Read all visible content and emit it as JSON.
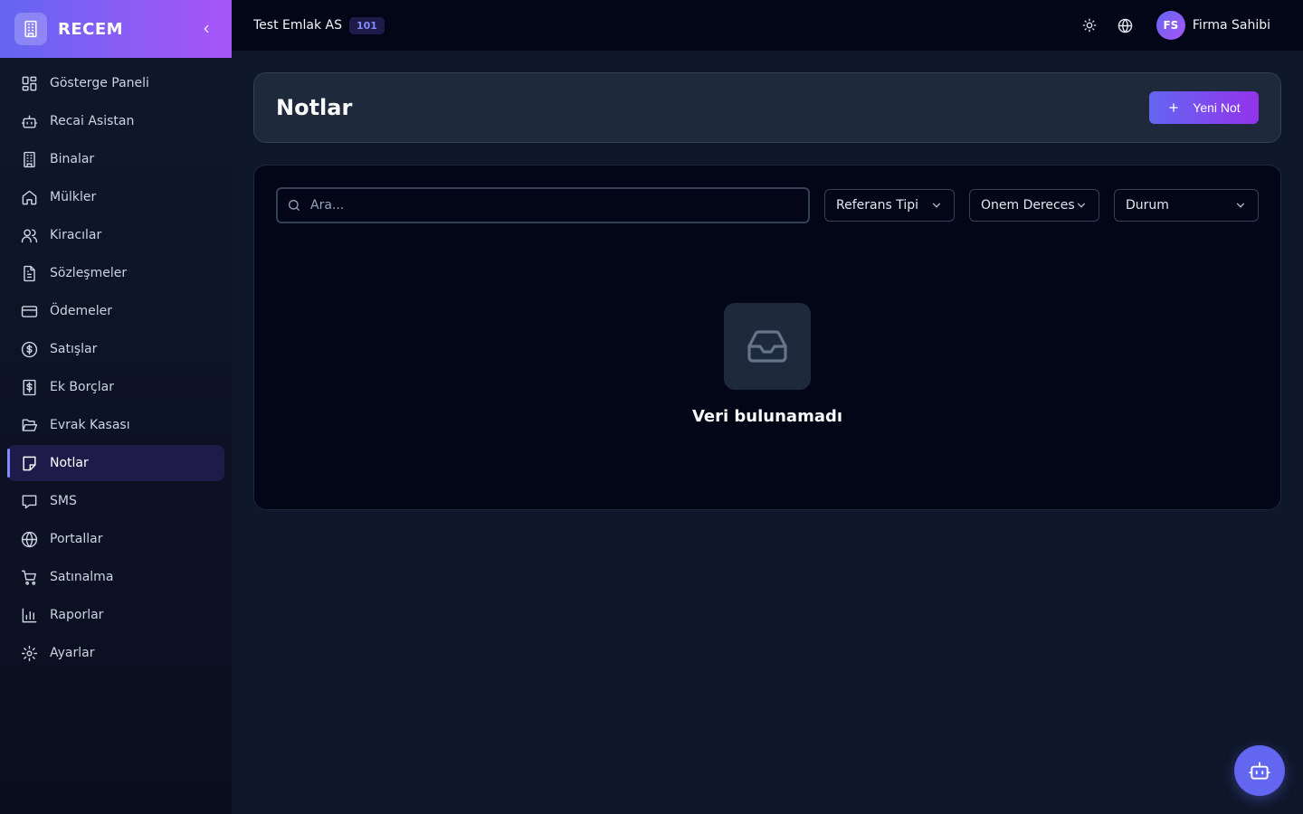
{
  "brand": {
    "name": "RECEM"
  },
  "sidebar": {
    "items": [
      {
        "label": "Gösterge Paneli",
        "icon": "dashboard-icon"
      },
      {
        "label": "Recai Asistan",
        "icon": "bot-icon"
      },
      {
        "label": "Binalar",
        "icon": "building-icon"
      },
      {
        "label": "Mülkler",
        "icon": "home-icon"
      },
      {
        "label": "Kiracılar",
        "icon": "users-icon"
      },
      {
        "label": "Sözleşmeler",
        "icon": "file-text-icon"
      },
      {
        "label": "Ödemeler",
        "icon": "credit-card-icon"
      },
      {
        "label": "Satışlar",
        "icon": "dollar-circle-icon"
      },
      {
        "label": "Ek Borçlar",
        "icon": "receipt-icon"
      },
      {
        "label": "Evrak Kasası",
        "icon": "folder-open-icon"
      },
      {
        "label": "Notlar",
        "icon": "sticky-note-icon",
        "active": true
      },
      {
        "label": "SMS",
        "icon": "message-icon"
      },
      {
        "label": "Portallar",
        "icon": "globe-icon"
      },
      {
        "label": "Satınalma",
        "icon": "cart-icon"
      },
      {
        "label": "Raporlar",
        "icon": "bar-chart-icon"
      },
      {
        "label": "Ayarlar",
        "icon": "settings-icon"
      }
    ]
  },
  "topbar": {
    "company": "Test Emlak AS",
    "company_code": "101",
    "user_initials": "FS",
    "user_name": "Firma Sahibi"
  },
  "page": {
    "title": "Notlar",
    "new_button": "Yeni Not"
  },
  "filters": {
    "search_placeholder": "Ara...",
    "reference_type": "Referans Tipi",
    "priority": "Önem Derecesi",
    "status": "Durum"
  },
  "empty_state": {
    "message": "Veri bulunamadı"
  },
  "colors": {
    "accent": "#6366f1",
    "accent2": "#a855f7",
    "background": "#0f172a",
    "card": "#1e293b"
  }
}
